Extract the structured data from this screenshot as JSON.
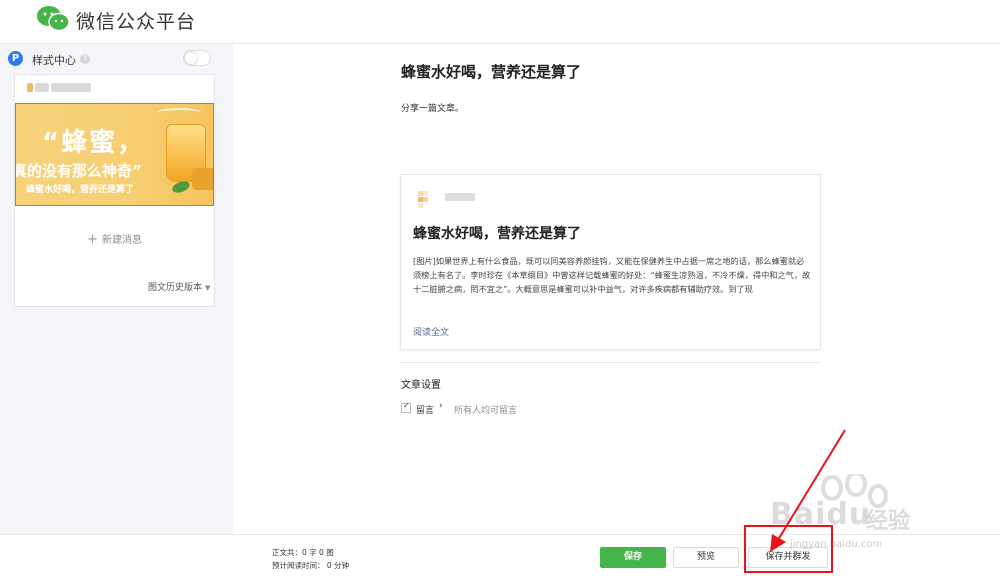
{
  "header": {
    "brand": "微信公众平台",
    "logo_icon": "wechat-logo-icon"
  },
  "sidebar": {
    "style_center_label": "样式中心",
    "help_glyph": "?",
    "badge_letter": "P",
    "cover": {
      "quote_text": "“蜂蜜，",
      "sub_text": "真的没有那么神奇”",
      "strip_text": "蜂蜜水好喝，营养还是算了"
    },
    "new_message_label": "新建消息",
    "history_label": "图文历史版本"
  },
  "article": {
    "title": "蜂蜜水好喝，营养还是算了",
    "description": "分享一篇文章。",
    "preview": {
      "title": "蜂蜜水好喝，营养还是算了",
      "body": "[图片]如果世界上有什么食品，既可以同美容养颜挂钩，又能在保健养生中占据一席之地的话，那么蜂蜜就必须榜上有名了。李时珍在《本草纲目》中曾这样记载蜂蜜的好处：“蜂蜜生凉熟温，不冷不燥，得中和之气，故十二脏腑之病，罔不宜之”。大概意思是蜂蜜可以补中益气，对许多疾病都有辅助疗效。到了现",
      "read_more": "阅读全文"
    },
    "settings": {
      "title": "文章设置",
      "comment_label": "留言",
      "comment_value": "所有人均可留言",
      "comment_checked": true
    }
  },
  "bottom": {
    "word_count": "正文共：0 字 0 图",
    "read_time": "预计阅读时间： 0 分钟",
    "save_label": "保存",
    "preview_label": "预览",
    "publish_label": "保存并群发"
  },
  "watermark": {
    "brand": "Bai",
    "brand2": "du",
    "cn": "经验",
    "url": "jingyan.baidu.com"
  },
  "colors": {
    "primary_green": "#44b549",
    "annotation_red": "#e8141b",
    "link_blue": "#576b95",
    "badge_blue": "#2d7bf4"
  }
}
